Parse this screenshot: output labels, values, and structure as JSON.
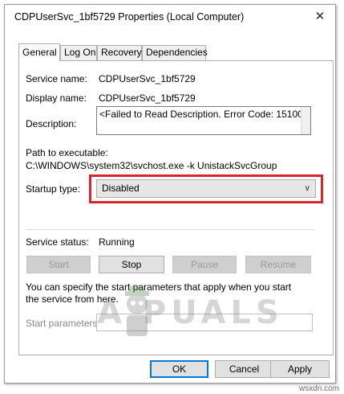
{
  "window": {
    "title": "CDPUserSvc_1bf5729 Properties (Local Computer)",
    "close_glyph": "✕"
  },
  "tabs": [
    {
      "label": "General",
      "active": true
    },
    {
      "label": "Log On",
      "active": false
    },
    {
      "label": "Recovery",
      "active": false
    },
    {
      "label": "Dependencies",
      "active": false
    }
  ],
  "general": {
    "service_name_label": "Service name:",
    "service_name_value": "CDPUserSvc_1bf5729",
    "display_name_label": "Display name:",
    "display_name_value": "CDPUserSvc_1bf5729",
    "description_label": "Description:",
    "description_value": "<Failed to Read Description. Error Code: 15100 >",
    "path_label": "Path to executable:",
    "path_value": "C:\\WINDOWS\\system32\\svchost.exe -k UnistackSvcGroup",
    "startup_type_label": "Startup type:",
    "startup_type_value": "Disabled",
    "service_status_label": "Service status:",
    "service_status_value": "Running",
    "buttons": {
      "start": "Start",
      "stop": "Stop",
      "pause": "Pause",
      "resume": "Resume"
    },
    "start_params_info": "You can specify the start parameters that apply when you start the service from here.",
    "start_params_label": "Start parameters:",
    "start_params_value": ""
  },
  "dialog_buttons": {
    "ok": "OK",
    "cancel": "Cancel",
    "apply": "Apply"
  },
  "watermark": "A  PUALS",
  "corner_mark": "wsxdn.com",
  "colors": {
    "highlight": "#d8262c",
    "default_button_border": "#0078d7"
  }
}
